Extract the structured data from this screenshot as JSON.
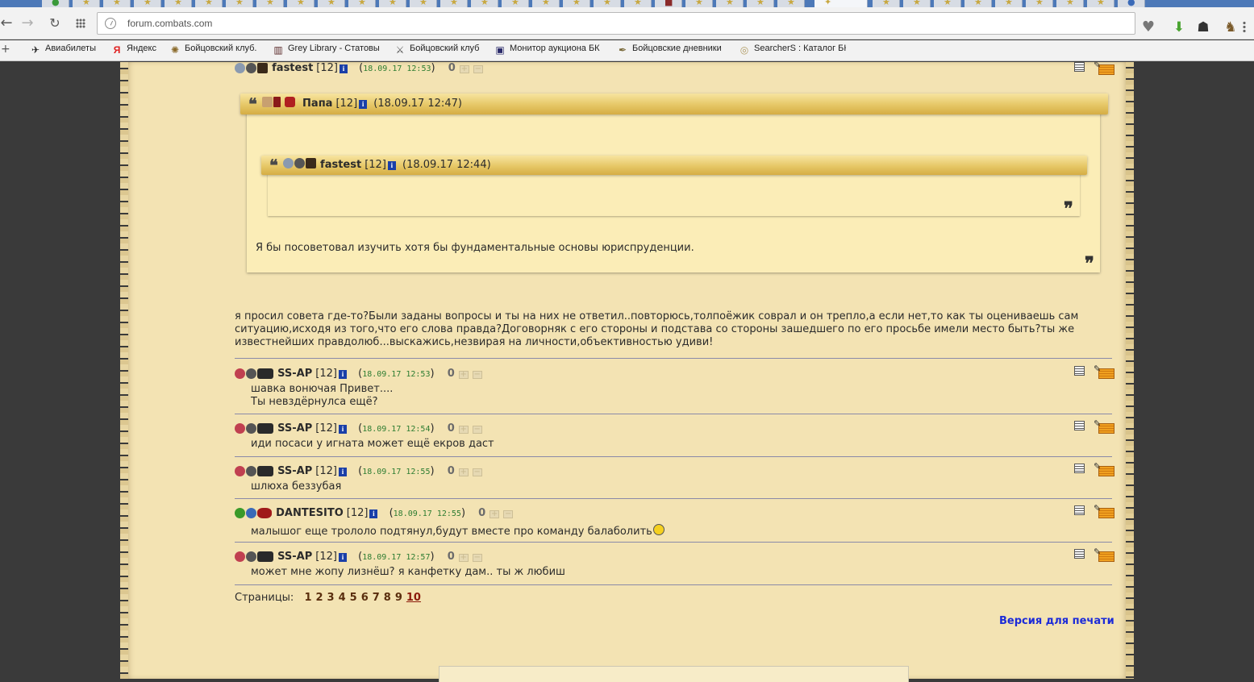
{
  "browser": {
    "url": "forum.combats.com",
    "bookmarks": [
      {
        "label": "Авиабилеты",
        "icon": "plane-icon"
      },
      {
        "label": "Яндекс",
        "icon": "yandex-icon"
      },
      {
        "label": "Бойцовский клуб.",
        "icon": "bk-icon"
      },
      {
        "label": "Grey Library - Статовы",
        "icon": "library-icon"
      },
      {
        "label": "Бойцовский клуб",
        "icon": "swords-icon"
      },
      {
        "label": "Монитор аукциона БК",
        "icon": "monitor-icon"
      },
      {
        "label": "Бойцовские дневники",
        "icon": "feather-icon"
      },
      {
        "label": "SearcherS : Каталог БК",
        "icon": "searchers-icon"
      }
    ]
  },
  "thread": {
    "top_post": {
      "nick": "fastest",
      "level": "[12]",
      "date": "18.09.17 12:53",
      "rating": "0",
      "quote_outer": {
        "nick": "Папа",
        "level": "[12]",
        "date": "(18.09.17 12:47)",
        "text": "Я бы посоветовал изучить хотя бы фундаментальные основы юриспруденции."
      },
      "quote_inner": {
        "nick": "fastest",
        "level": "[12]",
        "date": "(18.09.17 12:44)"
      },
      "text": "я просил совета где-то?Были заданы вопросы и ты на них не ответил..повторюсь,толпоёжик соврал и он трепло,а если нет,то как ты оцениваешь сам ситуацию,исходя из того,что его слова правда?Договорняк с его стороны и подстава со стороны зашедшего по его просьбе имели место быть?ты же известнейших правдолюб...выскажись,незвирая на личности,объективностью удиви!"
    },
    "posts": [
      {
        "nick": "SS-AP",
        "level": "[12]",
        "date": "18.09.17 12:53",
        "rating": "0",
        "line1": "шавка вонючая Привет....",
        "line2": "Ты невздёрнулса ещё?"
      },
      {
        "nick": "SS-AP",
        "level": "[12]",
        "date": "18.09.17 12:54",
        "rating": "0",
        "line1": "иди посаси у игната может ещё екров даст"
      },
      {
        "nick": "SS-AP",
        "level": "[12]",
        "date": "18.09.17 12:55",
        "rating": "0",
        "line1": "шлюха беззубая"
      },
      {
        "nick": "DANTESITO",
        "level": "[12]",
        "date": "18.09.17 12:55",
        "rating": "0",
        "line1": "малышог еще трололо подтянул,будут вместе про команду балаболить"
      },
      {
        "nick": "SS-AP",
        "level": "[12]",
        "date": "18.09.17 12:57",
        "rating": "0",
        "line1": "может мне жопу лизнёш? я канфетку дам.. ты ж любиш"
      }
    ],
    "info_glyph": "i",
    "open_paren": "(",
    "close_paren": ")"
  },
  "pagination": {
    "label": "Страницы:",
    "pages": [
      "1",
      "2",
      "3",
      "4",
      "5",
      "6",
      "7",
      "8",
      "9",
      "10"
    ],
    "current": "10"
  },
  "print_link": "Версия для печати",
  "colors": {
    "parchment": "#f3e3b3",
    "date_green": "#2e7d32",
    "print_link": "#1c2bd8",
    "page_link": "#5a2e0e"
  }
}
